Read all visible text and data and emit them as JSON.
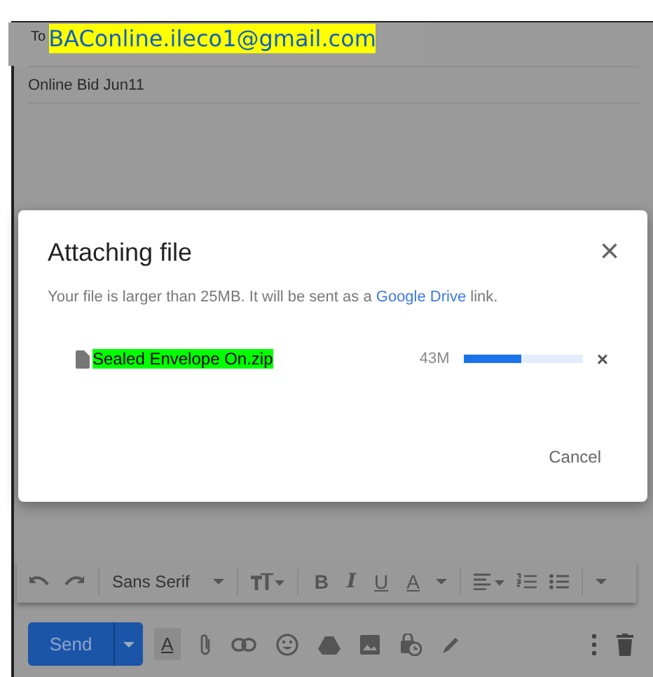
{
  "compose": {
    "to_label": "To",
    "to": "BAConline.ileco1@gmail.com",
    "subject": "Online Bid Jun11"
  },
  "dialog": {
    "title": "Attaching file",
    "close": "×",
    "message_before": "Your file is larger than 25MB. It will be sent as a ",
    "link": "Google Drive",
    "message_after": " link.",
    "file": {
      "name": "Sealed Envelope On.zip",
      "size": "43M",
      "level": 0.48,
      "remove": "×"
    },
    "cancel": "Cancel"
  },
  "format_toolbar": {
    "font": "Sans Serif",
    "bold": "B",
    "italic": "I",
    "underline": "U",
    "text_color": "A"
  },
  "actions": {
    "send": "Send",
    "formatting": "A"
  }
}
